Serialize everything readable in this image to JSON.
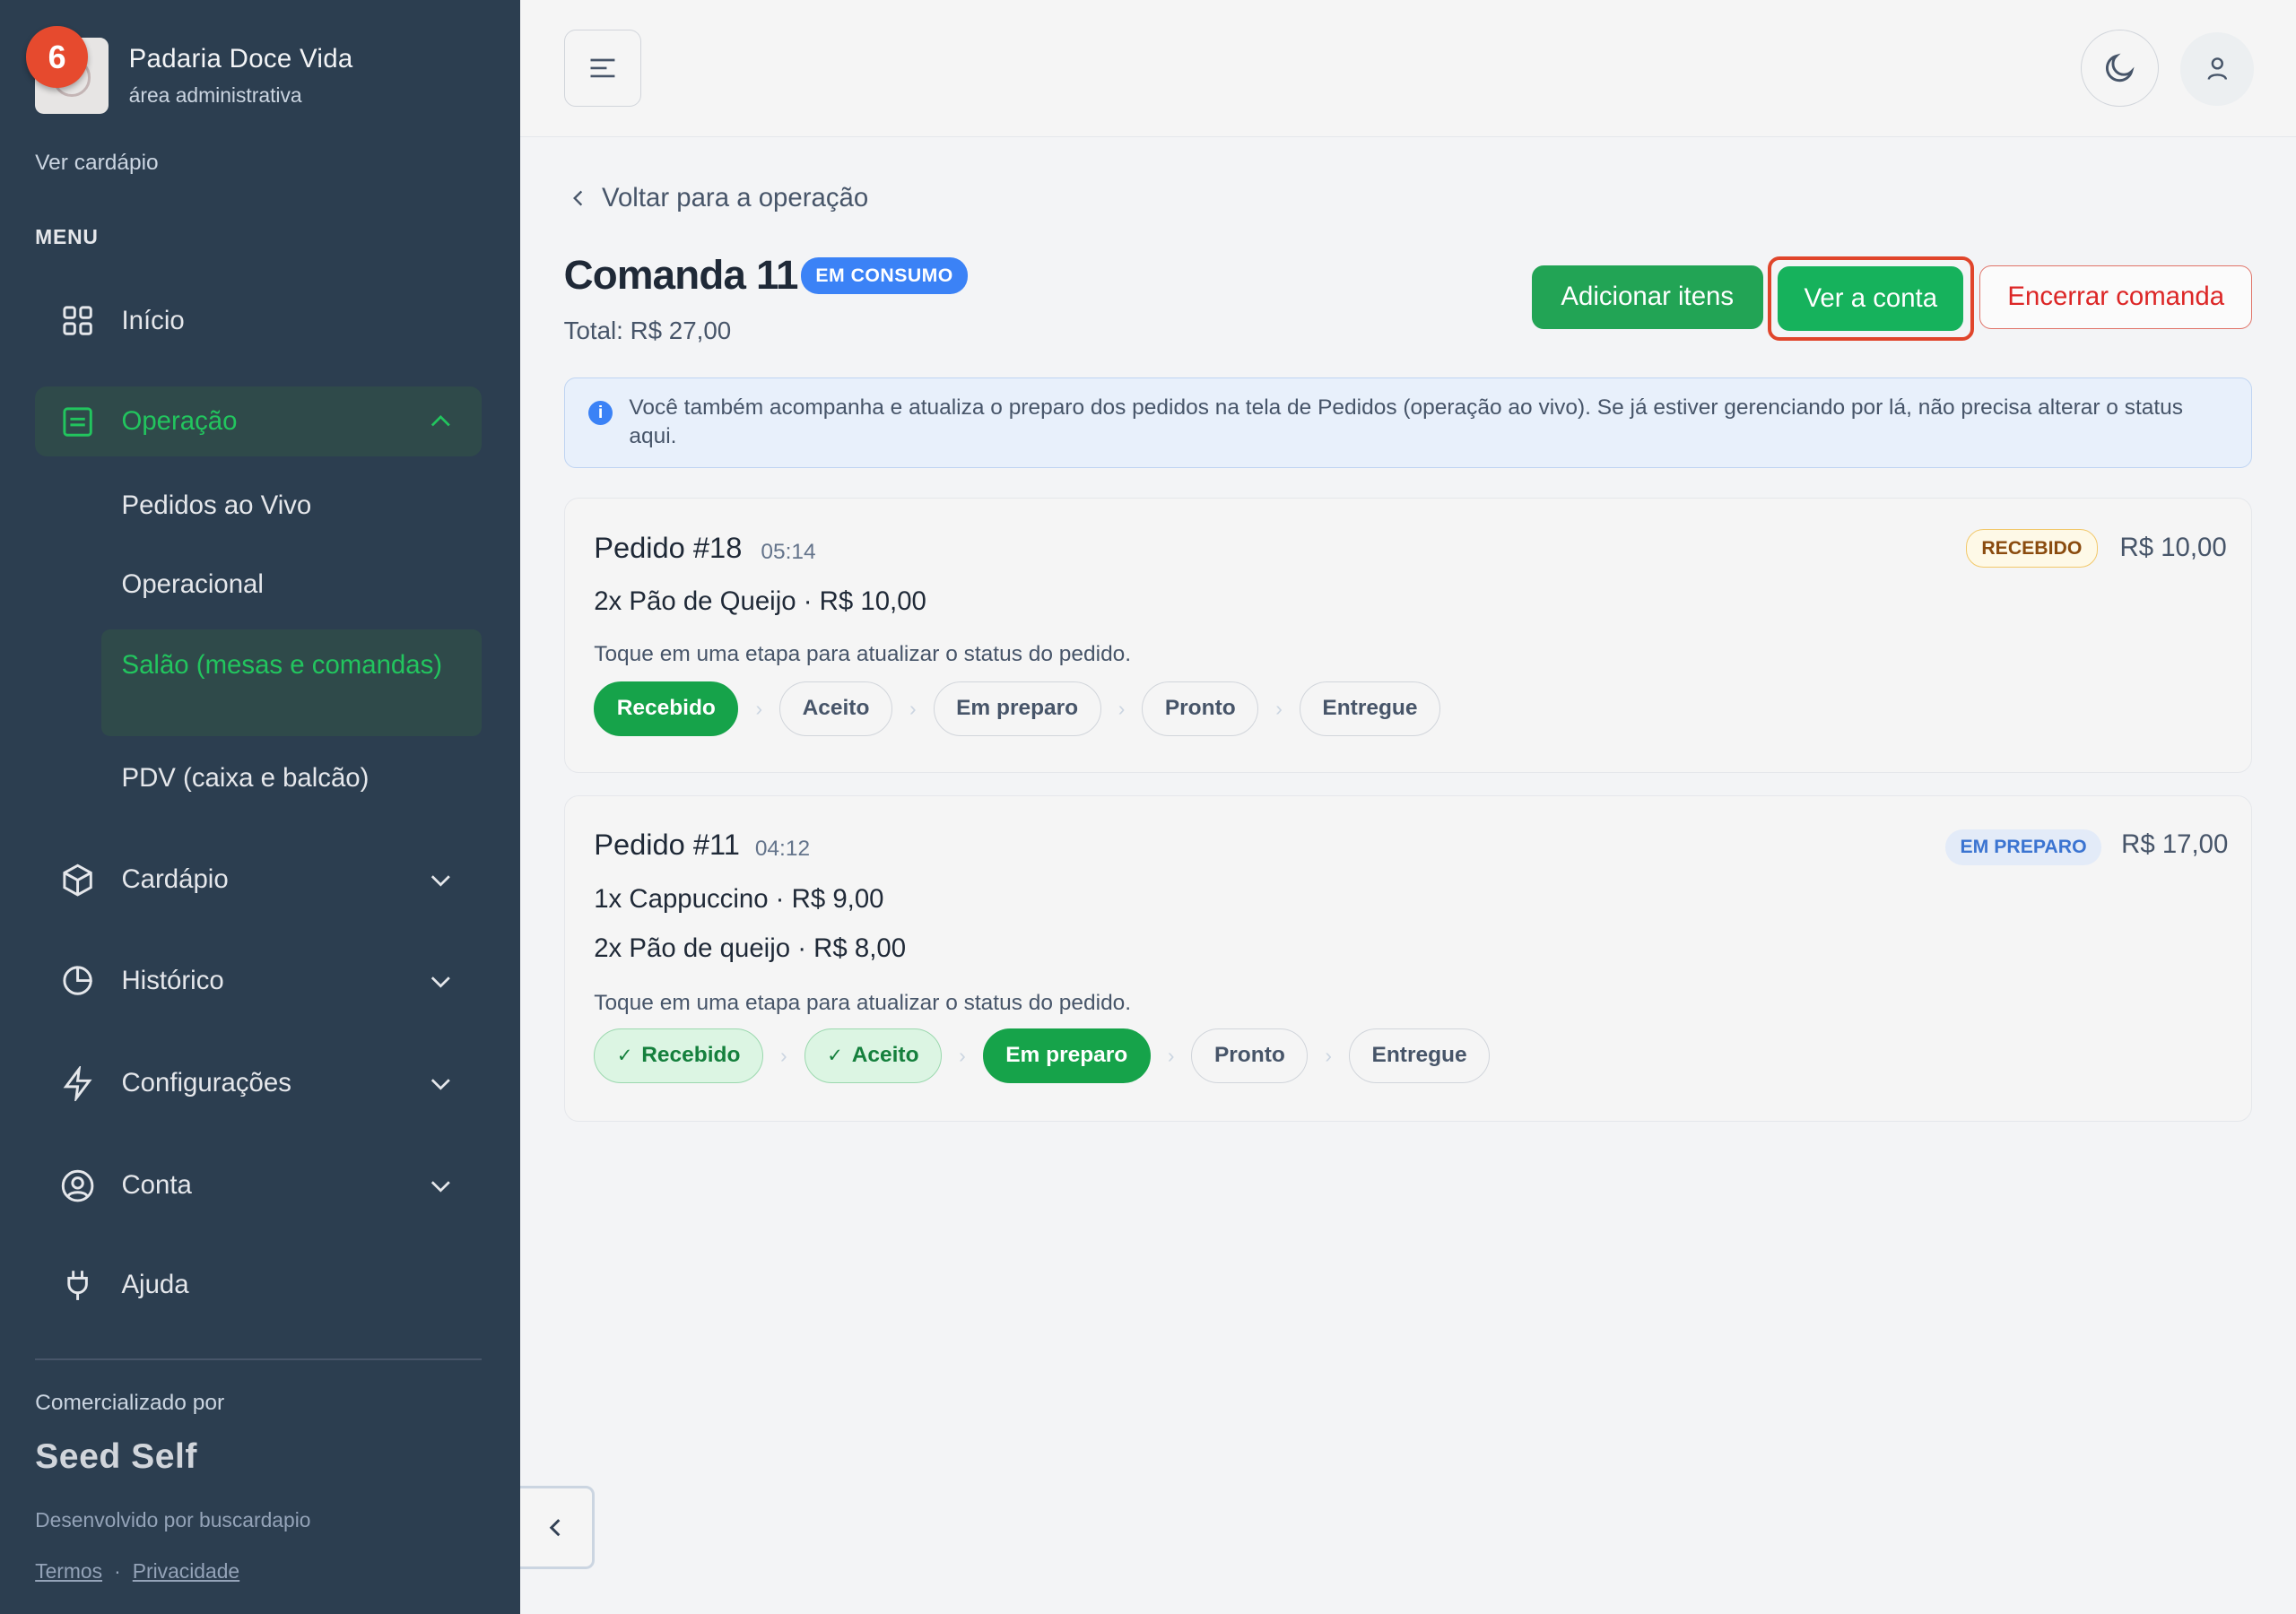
{
  "brand": {
    "name": "Padaria Doce Vida",
    "subtitle": "área administrativa",
    "notification_count": "6"
  },
  "sidebar": {
    "view_menu": "Ver cardápio",
    "menu_label": "MENU",
    "items": {
      "inicio": "Início",
      "operacao": "Operação",
      "cardapio": "Cardápio",
      "historico": "Histórico",
      "configuracoes": "Configurações",
      "conta": "Conta",
      "ajuda": "Ajuda"
    },
    "operacao_sub": {
      "pedidos": "Pedidos ao Vivo",
      "operacional": "Operacional",
      "salao": "Salão (mesas e comandas)",
      "pdv": "PDV (caixa e balcão)"
    },
    "footer": {
      "commercialized_by": "Comercializado por",
      "brand": "Seed Self",
      "developed_by": "Desenvolvido por buscardapio",
      "terms": "Termos",
      "separator": "·",
      "privacy": "Privacidade"
    }
  },
  "page": {
    "back": "Voltar para a operação",
    "title": "Comanda 11",
    "status": "EM CONSUMO",
    "total": "Total: R$ 27,00",
    "actions": {
      "add": "Adicionar itens",
      "bill": "Ver a conta",
      "close": "Encerrar comanda"
    },
    "info": "Você também acompanha e atualiza o preparo dos pedidos na tela de Pedidos (operação ao vivo). Se já estiver gerenciando por lá, não precisa alterar o status aqui."
  },
  "orders": [
    {
      "title": "Pedido #18",
      "time": "05:14",
      "status": "RECEBIDO",
      "price": "R$ 10,00",
      "items": [
        "2x Pão de Queijo · R$ 10,00"
      ],
      "hint": "Toque em uma etapa para atualizar o status do pedido.",
      "steps": [
        "Recebido",
        "Aceito",
        "Em preparo",
        "Pronto",
        "Entregue"
      ]
    },
    {
      "title": "Pedido #11",
      "time": "04:12",
      "status": "EM PREPARO",
      "price": "R$ 17,00",
      "items": [
        "1x Cappuccino · R$ 9,00",
        "2x Pão de queijo · R$ 8,00"
      ],
      "hint": "Toque em uma etapa para atualizar o status do pedido.",
      "steps": [
        "Recebido",
        "Aceito",
        "Em preparo",
        "Pronto",
        "Entregue"
      ]
    }
  ],
  "icons": {
    "check": "✓",
    "step_arrow": "›",
    "info": "i"
  },
  "colors": {
    "sidebar_bg": "#2c3e50",
    "accent_green": "#16a34a",
    "status_blue": "#3b82f6",
    "danger": "#dc2626"
  }
}
